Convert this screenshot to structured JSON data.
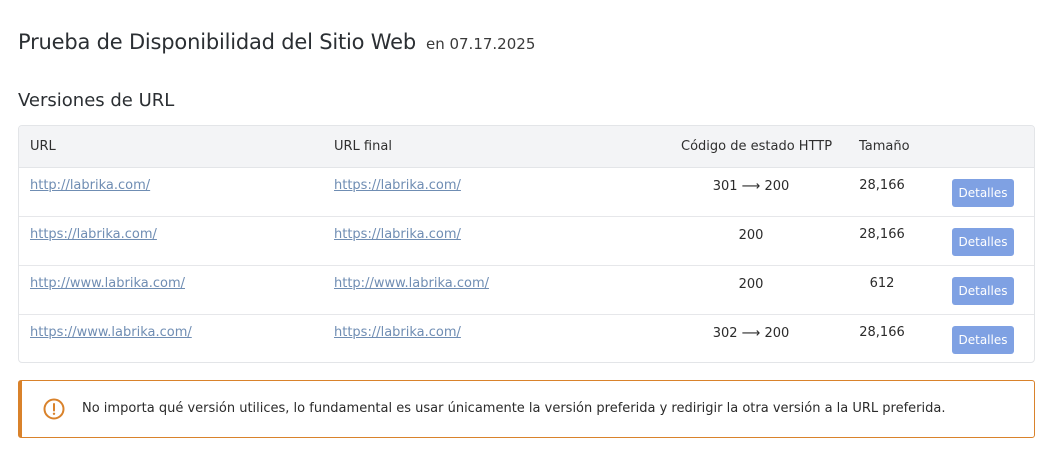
{
  "header": {
    "title": "Prueba de Disponibilidad del Sitio Web",
    "date": "en 07.17.2025"
  },
  "section": {
    "title": "Versiones de URL"
  },
  "table": {
    "columns": {
      "url": "URL",
      "final_url": "URL final",
      "status": "Código de estado HTTP",
      "size": "Tamaño"
    },
    "rows": [
      {
        "url": "http://labrika.com/",
        "final_url": "https://labrika.com/",
        "status": "301 ⟶ 200",
        "size": "28,166",
        "button": "Detalles"
      },
      {
        "url": "https://labrika.com/",
        "final_url": "https://labrika.com/",
        "status": "200",
        "size": "28,166",
        "button": "Detalles"
      },
      {
        "url": "http://www.labrika.com/",
        "final_url": "http://www.labrika.com/",
        "status": "200",
        "size": "612",
        "button": "Detalles"
      },
      {
        "url": "https://www.labrika.com/",
        "final_url": "https://labrika.com/",
        "status": "302 ⟶ 200",
        "size": "28,166",
        "button": "Detalles"
      }
    ]
  },
  "notice": {
    "icon": "exclamation-circle-icon",
    "color": "#d9822b",
    "text": "No importa qué versión utilices, lo fundamental es usar únicamente la versión preferida y redirigir la otra versión a la URL preferida."
  },
  "colors": {
    "link": "#6f8db3",
    "button": "#7fa1e3",
    "header_bg": "#f3f4f6"
  }
}
